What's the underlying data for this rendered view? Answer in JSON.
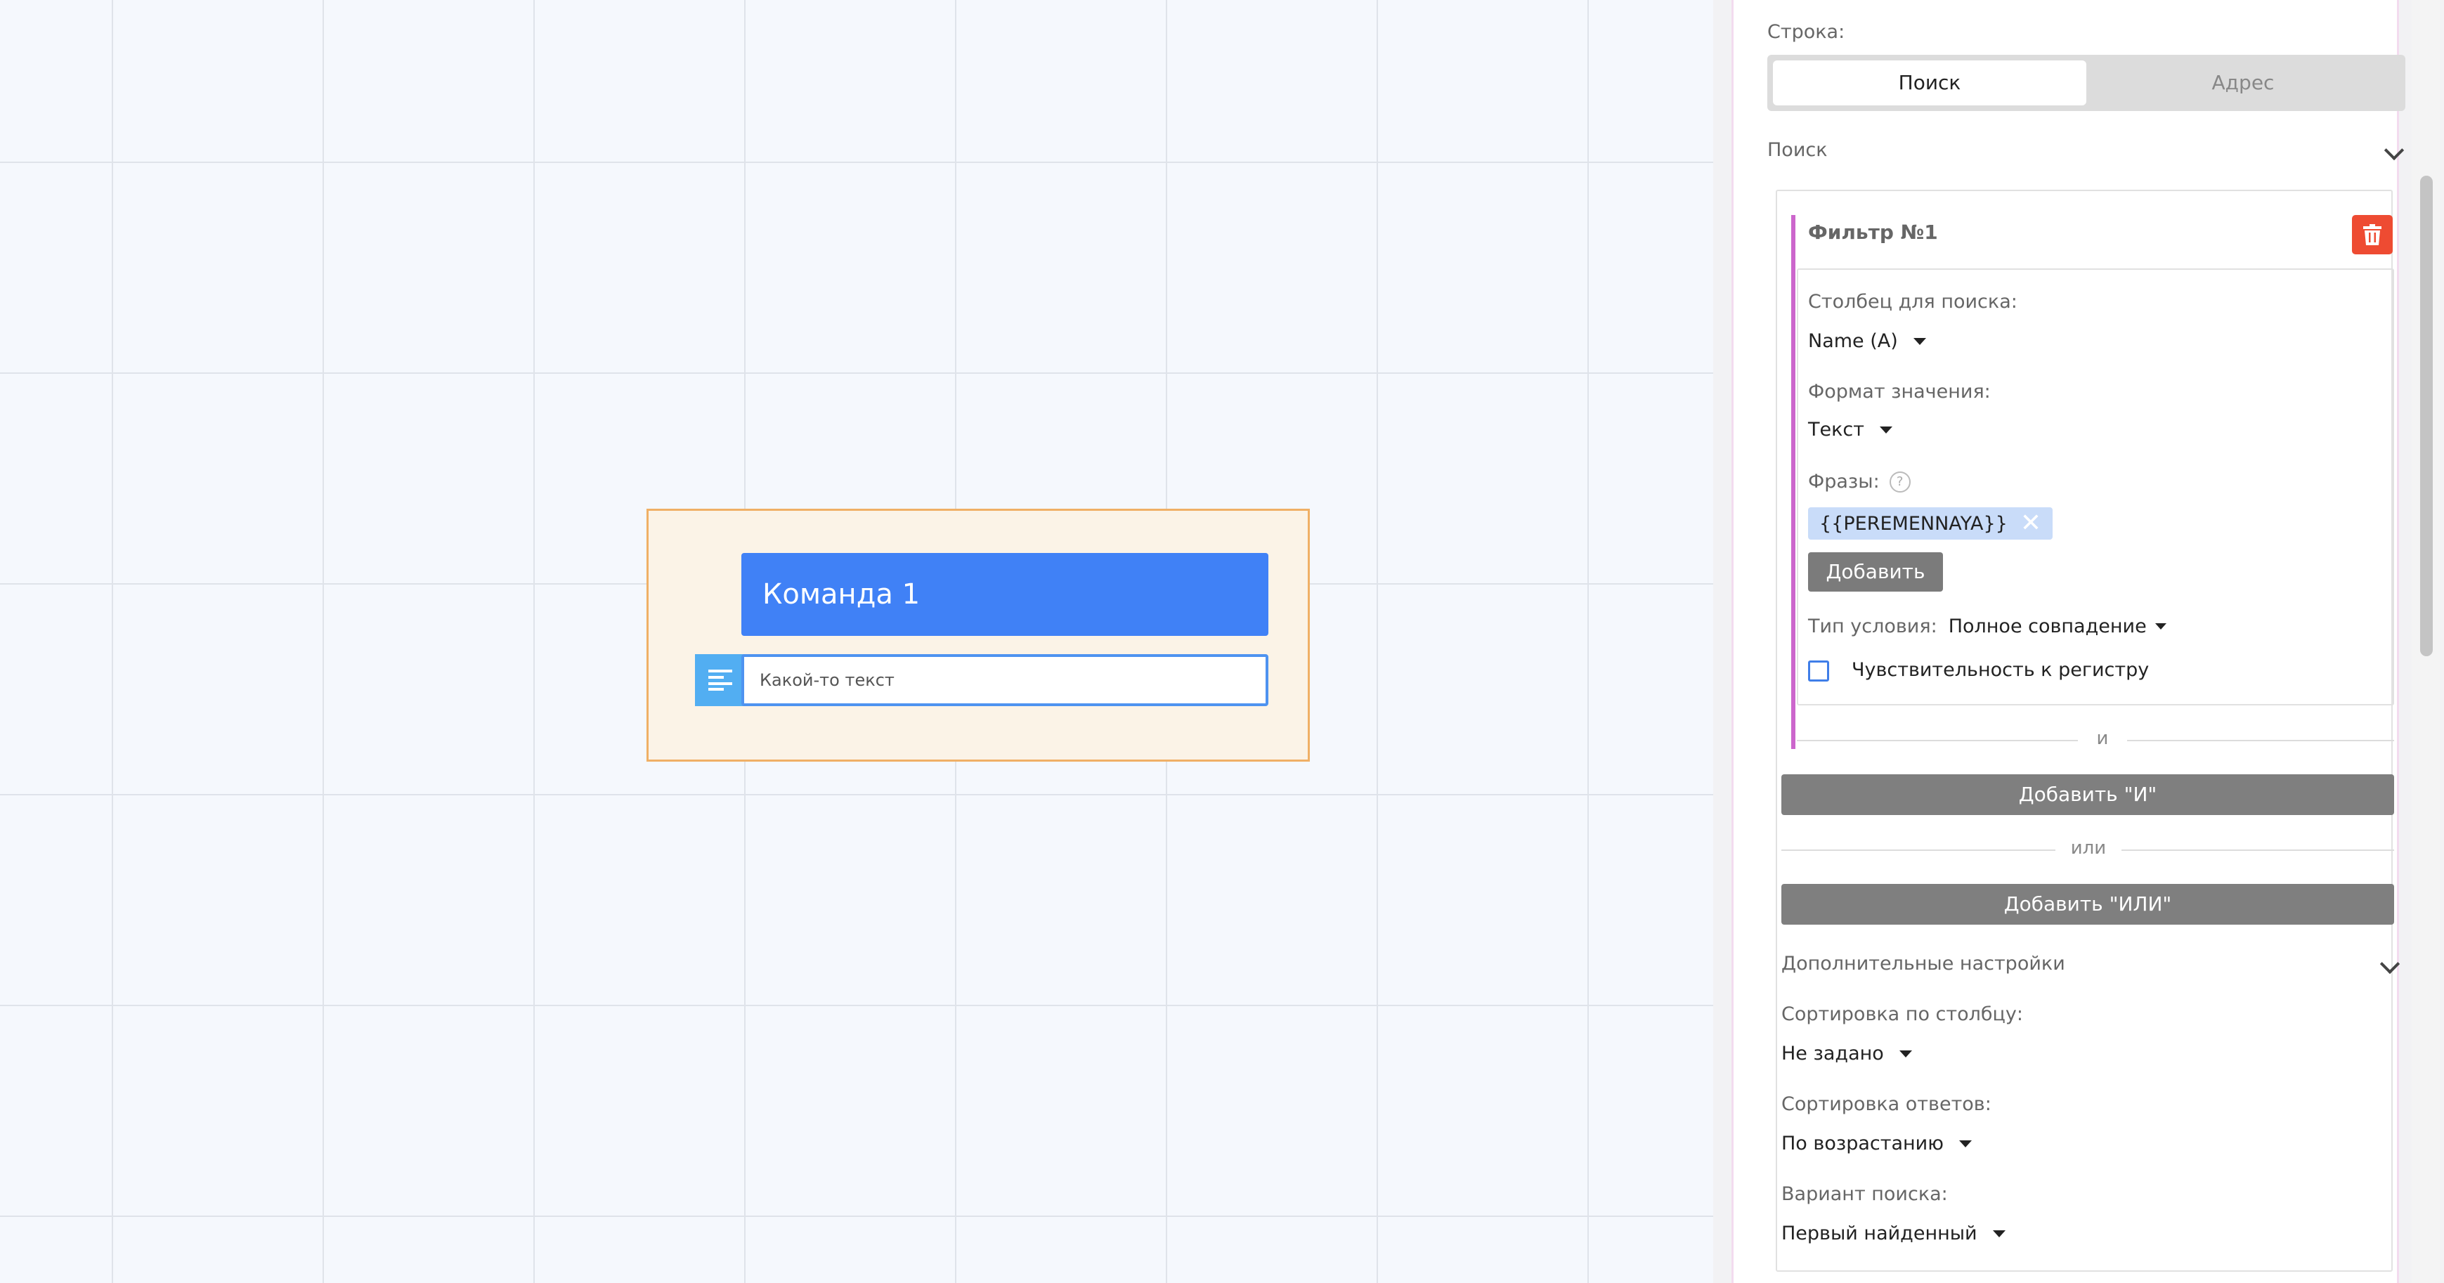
{
  "canvas": {
    "node": {
      "title": "Команда 1",
      "text": "Какой-то текст"
    }
  },
  "panel": {
    "row_label": "Строка:",
    "row_tabs": [
      "Поиск",
      "Адрес"
    ],
    "row_tab_selected": "Поиск",
    "search_section": "Поиск",
    "filter": {
      "title": "Фильтр №1",
      "column_label": "Столбец для поиска:",
      "column_value": "Name (A)",
      "format_label": "Формат значения:",
      "format_value": "Текст",
      "phrases_label": "Фразы:",
      "help_glyph": "?",
      "phrase_tags": [
        "{{PEREMENNAYA}}"
      ],
      "tag_remove_glyph": "✕",
      "add_label": "Добавить",
      "condition_label": "Тип условия:",
      "condition_value": "Полное совпадение",
      "case_label": "Чувствительность к регистру",
      "case_checked": false
    },
    "and_label": "и",
    "add_and": "Добавить \"И\"",
    "or_label": "или",
    "add_or": "Добавить \"ИЛИ\"",
    "extra_section": "Дополнительные настройки",
    "sort_column_label": "Сортировка по столбцу:",
    "sort_column_value": "Не задано",
    "sort_answers_label": "Сортировка ответов:",
    "sort_answers_value": "По возрастанию",
    "search_variant_label": "Вариант поиска:",
    "search_variant_value": "Первый найденный"
  },
  "colors": {
    "accent": "#4081f6",
    "delete": "#ee4b32",
    "node_border": "#f0b066",
    "filter_accent": "#cc66cc"
  }
}
